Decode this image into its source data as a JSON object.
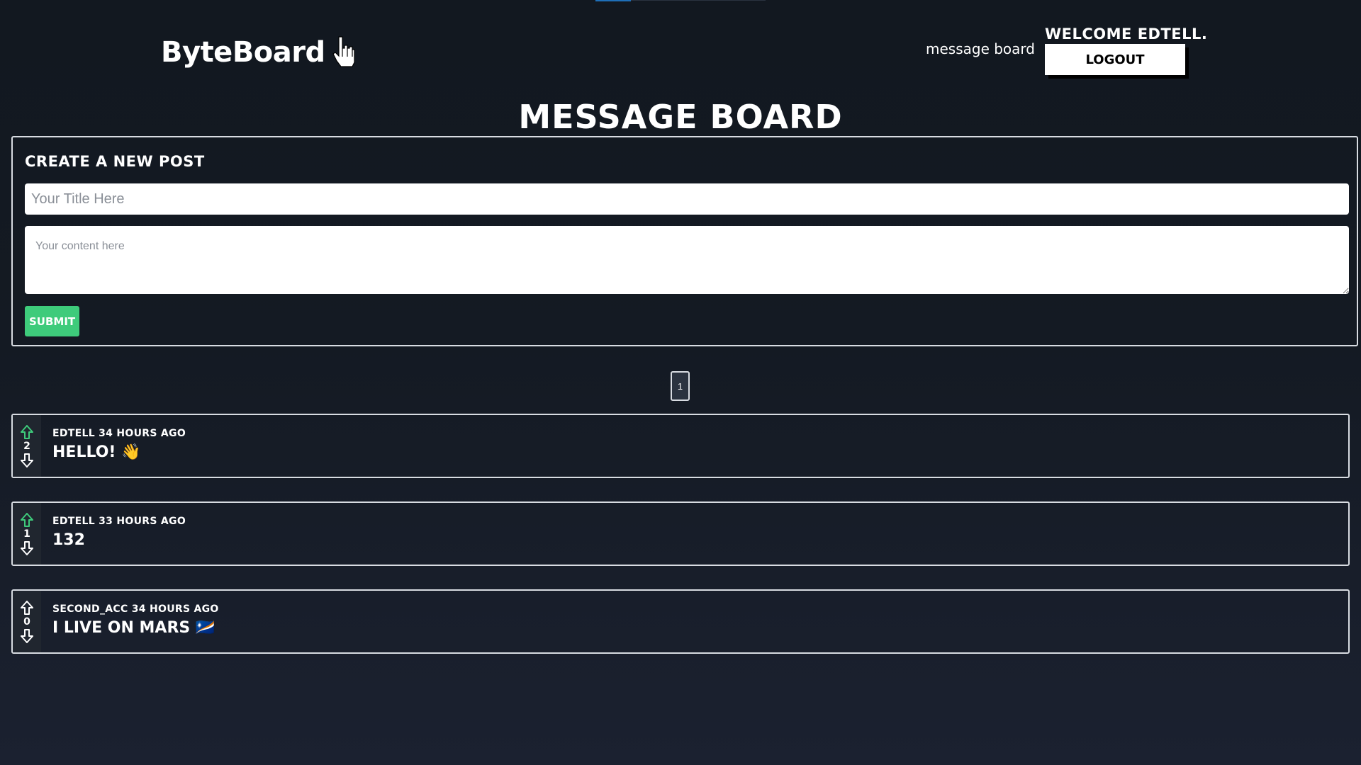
{
  "brand": {
    "name": "ByteBoard",
    "logo_icon": "pointer-hand-icon"
  },
  "nav": {
    "message_board_link": "message board"
  },
  "user": {
    "welcome_text": "WELCOME EDTELL.",
    "logout_label": "LOGOUT"
  },
  "page": {
    "title": "MESSAGE BOARD"
  },
  "create_post": {
    "heading": "CREATE A NEW POST",
    "title_placeholder": "Your Title Here",
    "title_value": "",
    "content_placeholder": "Your content here",
    "content_value": "",
    "submit_label": "SUBMIT"
  },
  "pagination": {
    "pages": [
      "1"
    ],
    "current": "1"
  },
  "posts": [
    {
      "meta": "EDTELL 34 HOURS AGO",
      "title": "HELLO! 👋",
      "score": "2",
      "vote_state": "upvoted"
    },
    {
      "meta": "EDTELL 33 HOURS AGO",
      "title": "132",
      "score": "1",
      "vote_state": "upvoted"
    },
    {
      "meta": "SECOND_ACC 34 HOURS AGO",
      "title": "I LIVE ON MARS 🇲🇭",
      "score": "0",
      "vote_state": "none"
    }
  ],
  "colors": {
    "background": "#121820",
    "accent_green": "#3ecb7b",
    "upvote_active": "#3ecb7b",
    "border": "#d8dce2",
    "indicator_blue": "#1e6fb8"
  }
}
